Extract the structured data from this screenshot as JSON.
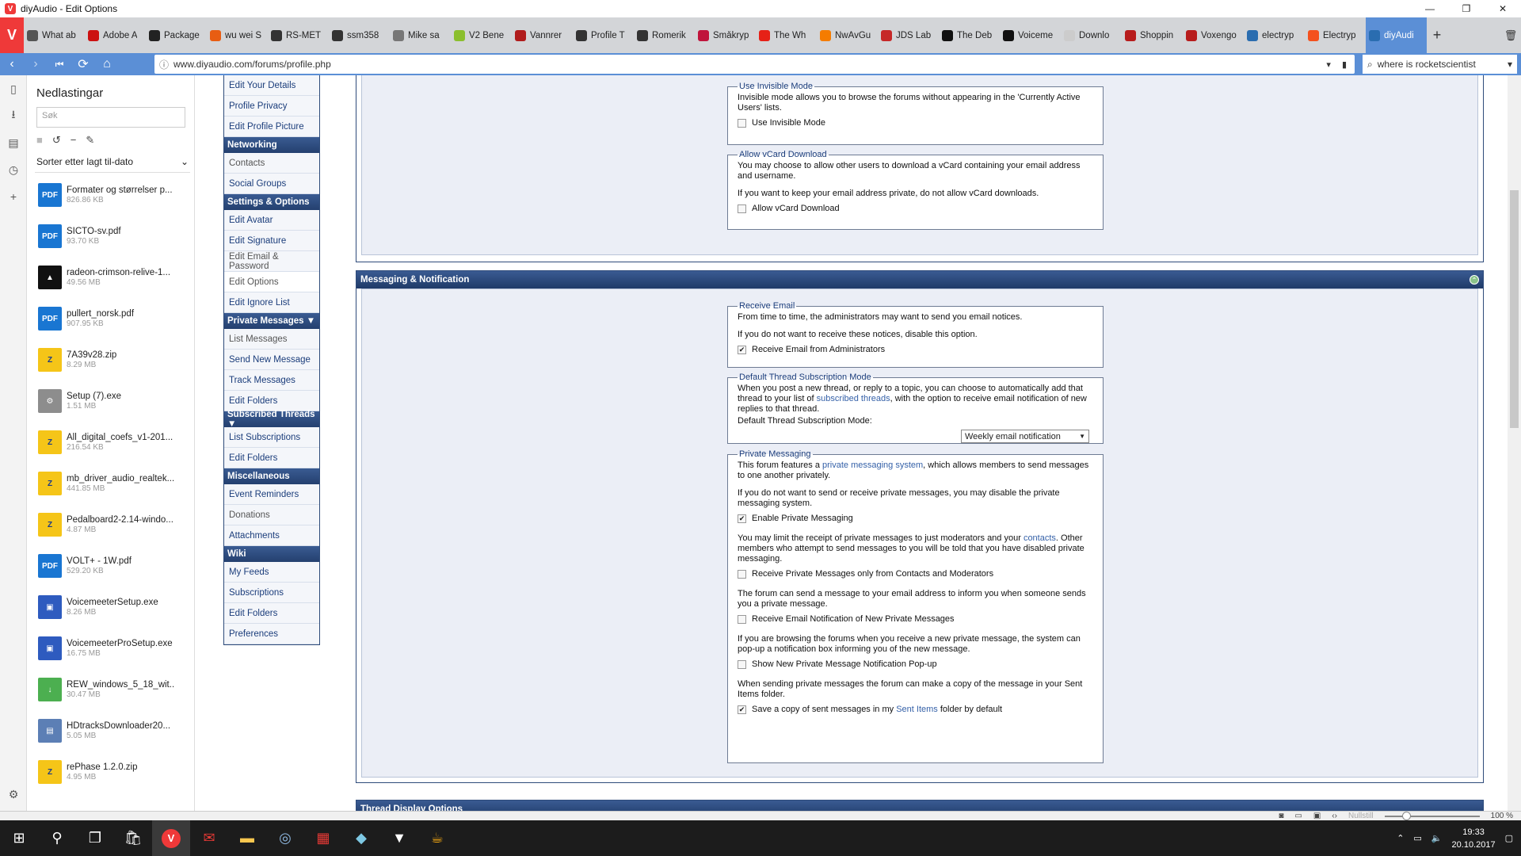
{
  "window": {
    "title": "diyAudio - Edit Options",
    "minimize": "—",
    "restore": "❐",
    "close": "✕"
  },
  "tabs": [
    {
      "label": "What ab",
      "color": "#555"
    },
    {
      "label": "Adobe A",
      "color": "#cc1111"
    },
    {
      "label": "Package",
      "color": "#222"
    },
    {
      "label": "wu wei S",
      "color": "#e85d12"
    },
    {
      "label": "RS-MET",
      "color": "#333"
    },
    {
      "label": "ssm358",
      "color": "#333"
    },
    {
      "label": "Mike sa",
      "color": "#777"
    },
    {
      "label": "V2 Bene",
      "color": "#8bbf2e"
    },
    {
      "label": "Vannrer",
      "color": "#b01c1c"
    },
    {
      "label": "Profile T",
      "color": "#333"
    },
    {
      "label": "Romerik",
      "color": "#333"
    },
    {
      "label": "Småkryp",
      "color": "#c0143c"
    },
    {
      "label": "The Wh",
      "color": "#e62117"
    },
    {
      "label": "NwAvGu",
      "color": "#f57c00"
    },
    {
      "label": "JDS Lab",
      "color": "#c62828"
    },
    {
      "label": "The Deb",
      "color": "#111"
    },
    {
      "label": "Voiceme",
      "color": "#111"
    },
    {
      "label": "Downlo",
      "color": "#ccc"
    },
    {
      "label": "Shoppin",
      "color": "#b71c1c"
    },
    {
      "label": "Voxengo",
      "color": "#b71c1c"
    },
    {
      "label": "electryp",
      "color": "#2a6db0"
    },
    {
      "label": "Electryp",
      "color": "#f4511e"
    },
    {
      "label": "diyAudi",
      "color": "#2a6db0",
      "active": true
    }
  ],
  "nav": {
    "back": "‹",
    "forward": "›",
    "rewind": "⏮",
    "reload": "⟳",
    "home": "⌂"
  },
  "address": {
    "url": "www.diyaudio.com/forums/profile.php",
    "dropdown": "▾",
    "bookmark": "🔖",
    "search_value": "where is rocketscientist",
    "search_dropdown": "▾"
  },
  "downloads": {
    "title": "Nedlastingar",
    "search_placeholder": "Søk",
    "sort_label": "Sorter etter lagt til-dato",
    "items": [
      {
        "name": "Formater og størrelser p...",
        "size": "826.86 KB",
        "icon": "pdf"
      },
      {
        "name": "SICTO-sv.pdf",
        "size": "93.70 KB",
        "icon": "pdf"
      },
      {
        "name": "radeon-crimson-relive-1...",
        "size": "49.56 MB",
        "icon": "amd"
      },
      {
        "name": "pullert_norsk.pdf",
        "size": "907.95 KB",
        "icon": "pdf"
      },
      {
        "name": "7A39v28.zip",
        "size": "8.29 MB",
        "icon": "zip"
      },
      {
        "name": "Setup (7).exe",
        "size": "1.51 MB",
        "icon": "exe"
      },
      {
        "name": "All_digital_coefs_v1-201...",
        "size": "216.54 KB",
        "icon": "zip"
      },
      {
        "name": "mb_driver_audio_realtek...",
        "size": "441.85 MB",
        "icon": "zip"
      },
      {
        "name": "Pedalboard2-2.14-windo...",
        "size": "4.87 MB",
        "icon": "zip"
      },
      {
        "name": "VOLT+ - 1W.pdf",
        "size": "529.20 KB",
        "icon": "pdf"
      },
      {
        "name": "VoicemeeterSetup.exe",
        "size": "8.26 MB",
        "icon": "setup"
      },
      {
        "name": "VoicemeeterProSetup.exe",
        "size": "16.75 MB",
        "icon": "setup"
      },
      {
        "name": "REW_windows_5_18_wit...",
        "size": "30.47 MB",
        "icon": "rew"
      },
      {
        "name": "HDtracksDownloader20...",
        "size": "5.05 MB",
        "icon": "hd"
      },
      {
        "name": "rePhase 1.2.0.zip",
        "size": "4.95 MB",
        "icon": "zip"
      }
    ]
  },
  "leftnav": [
    {
      "type": "item",
      "label": "Edit Your Details"
    },
    {
      "type": "item",
      "label": "Profile Privacy"
    },
    {
      "type": "item",
      "label": "Edit Profile Picture"
    },
    {
      "type": "hdr",
      "label": "Networking"
    },
    {
      "type": "item",
      "label": "Contacts",
      "dim": true
    },
    {
      "type": "item",
      "label": "Social Groups"
    },
    {
      "type": "hdr",
      "label": "Settings & Options"
    },
    {
      "type": "item",
      "label": "Edit Avatar"
    },
    {
      "type": "item",
      "label": "Edit Signature"
    },
    {
      "type": "item",
      "label": "Edit Email & Password",
      "dim": true
    },
    {
      "type": "item",
      "label": "Edit Options",
      "current": true,
      "dim": true
    },
    {
      "type": "item",
      "label": "Edit Ignore List"
    },
    {
      "type": "hdr",
      "label": "Private Messages ▼"
    },
    {
      "type": "item",
      "label": "List Messages",
      "dim": true
    },
    {
      "type": "item",
      "label": "Send New Message"
    },
    {
      "type": "item",
      "label": "Track Messages"
    },
    {
      "type": "item",
      "label": "Edit Folders"
    },
    {
      "type": "hdr",
      "label": "Subscribed Threads ▼"
    },
    {
      "type": "item",
      "label": "List Subscriptions"
    },
    {
      "type": "item",
      "label": "Edit Folders"
    },
    {
      "type": "hdr",
      "label": "Miscellaneous"
    },
    {
      "type": "item",
      "label": "Event Reminders"
    },
    {
      "type": "item",
      "label": "Donations",
      "dim": true
    },
    {
      "type": "item",
      "label": "Attachments"
    },
    {
      "type": "hdr",
      "label": "Wiki"
    },
    {
      "type": "item",
      "label": "My Feeds"
    },
    {
      "type": "item",
      "label": "Subscriptions"
    },
    {
      "type": "item",
      "label": "Edit Folders"
    },
    {
      "type": "item",
      "label": "Preferences"
    }
  ],
  "invisible": {
    "legend": "Use Invisible Mode",
    "text": "Invisible mode allows you to browse the forums without appearing in the 'Currently Active Users' lists.",
    "checkbox": "Use Invisible Mode",
    "checked": false
  },
  "vcard": {
    "legend": "Allow vCard Download",
    "text1": "You may choose to allow other users to download a vCard containing your email address and username.",
    "text2": "If you want to keep your email address private, do not allow vCard downloads.",
    "checkbox": "Allow vCard Download",
    "checked": false
  },
  "messaging": {
    "title": "Messaging & Notification",
    "receive_email": {
      "legend": "Receive Email",
      "text1": "From time to time, the administrators may want to send you email notices.",
      "text2": "If you do not want to receive these notices, disable this option.",
      "checkbox": "Receive Email from Administrators",
      "checked": true
    },
    "subscription": {
      "legend": "Default Thread Subscription Mode",
      "text_a": "When you post a new thread, or reply to a topic, you can choose to automatically add that thread to your list of ",
      "link": "subscribed threads",
      "text_b": ", with the option to receive email notification of new replies to that thread.",
      "select_label": "Default Thread Subscription Mode:",
      "select_value": "Weekly email notification",
      "select_arrow": "▼"
    },
    "pm": {
      "legend": "Private Messaging",
      "intro_a": "This forum features a ",
      "intro_link": "private messaging system",
      "intro_b": ", which allows members to send messages to one another privately.",
      "disable_text": "If you do not want to send or receive private messages, you may disable the private messaging system.",
      "cb_enable": "Enable Private Messaging",
      "cb_enable_checked": true,
      "limit_a": "You may limit the receipt of private messages to just moderators and your ",
      "limit_link": "contacts",
      "limit_b": ". Other members who attempt to send messages to you will be told that you have disabled private messaging.",
      "cb_contacts": "Receive Private Messages only from Contacts and Moderators",
      "cb_contacts_checked": false,
      "email_text": "The forum can send a message to your email address to inform you when someone sends you a private message.",
      "cb_email": "Receive Email Notification of New Private Messages",
      "cb_email_checked": false,
      "popup_text": "If you are browsing the forums when you receive a new private message, the system can pop-up a notification box informing you of the new message.",
      "cb_popup": "Show New Private Message Notification Pop-up",
      "cb_popup_checked": false,
      "copy_text": "When sending private messages the forum can make a copy of the message in your Sent Items folder.",
      "cb_copy_a": "Save a copy of sent messages in my ",
      "cb_copy_link": "Sent Items",
      "cb_copy_b": " folder by default",
      "cb_copy_checked": true
    },
    "next_title": "Thread Display Options"
  },
  "statusbar": {
    "reset": "Nullstill",
    "zoom": "100 %"
  },
  "taskbar": {
    "time": "19:33",
    "date": "20.10.2017"
  },
  "colors": {
    "accent": "#5b8fd6",
    "vivaldi": "#ef3939",
    "nav_header": "#2e4b7a",
    "link": "#3561a8"
  }
}
